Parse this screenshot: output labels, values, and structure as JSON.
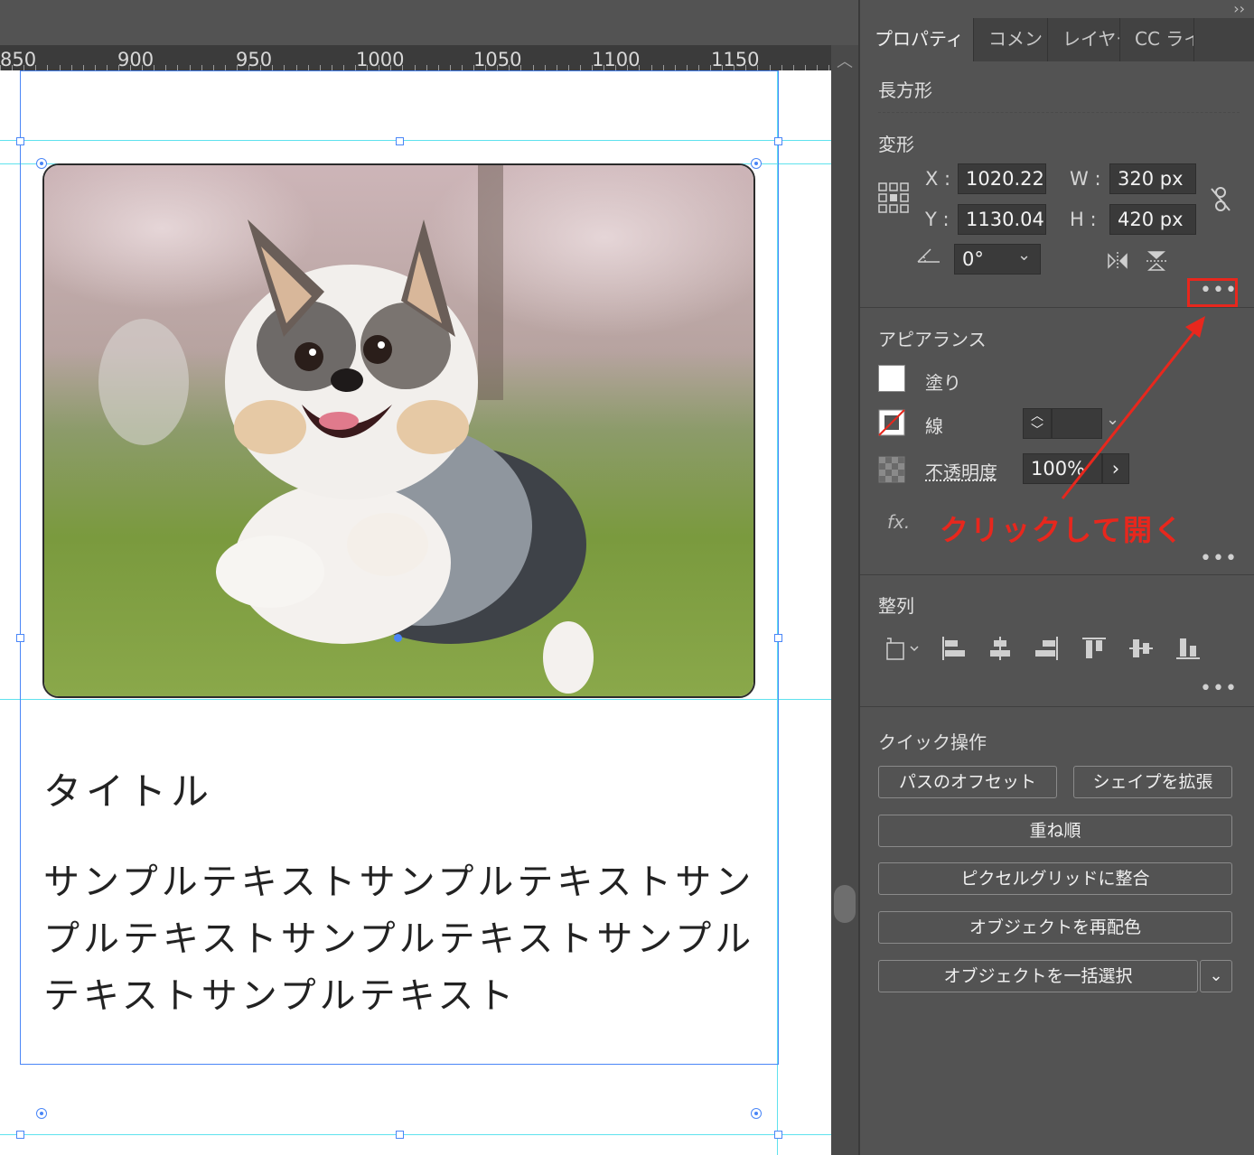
{
  "panel": {
    "collapse_glyph": "››",
    "tabs": [
      {
        "label": "プロパティ",
        "active": true
      },
      {
        "label": "コメント",
        "active": false
      },
      {
        "label": "レイヤー",
        "active": false
      },
      {
        "label": "CC ライ",
        "active": false
      }
    ],
    "object_type": "長方形",
    "transform": {
      "title": "変形",
      "x_label": "X :",
      "x_value": "1020.22",
      "y_label": "Y :",
      "y_value": "1130.04",
      "w_label": "W :",
      "w_value": "320 px",
      "h_label": "H :",
      "h_value": "420 px",
      "angle_value": "0°",
      "more": "•••"
    },
    "appearance": {
      "title": "アピアランス",
      "fill_label": "塗り",
      "stroke_label": "線",
      "opacity_label": "不透明度",
      "opacity_value": "100%",
      "fx_label": "fx.",
      "more": "•••"
    },
    "align": {
      "title": "整列",
      "more": "•••"
    },
    "quick_actions": {
      "title": "クイック操作",
      "offset_path": "パスのオフセット",
      "expand_shape": "シェイプを拡張",
      "arrange": "重ね順",
      "align_pixel_grid": "ピクセルグリッドに整合",
      "recolor": "オブジェクトを再配色",
      "select_all_same": "オブジェクトを一括選択"
    }
  },
  "ruler": {
    "labels": [
      "850",
      "900",
      "950",
      "1000",
      "1050",
      "1100",
      "1150"
    ]
  },
  "artboard": {
    "card_title": "タイトル",
    "card_body": "サンプルテキストサンプルテキストサンプルテキストサンプルテキストサンプルテキストサンプルテキスト"
  },
  "annotation": {
    "text": "クリックして開く",
    "color": "#e8271d"
  },
  "colors": {
    "selection": "#4a86f7",
    "guide": "#5fe2ee",
    "panel_bg": "#535353"
  }
}
